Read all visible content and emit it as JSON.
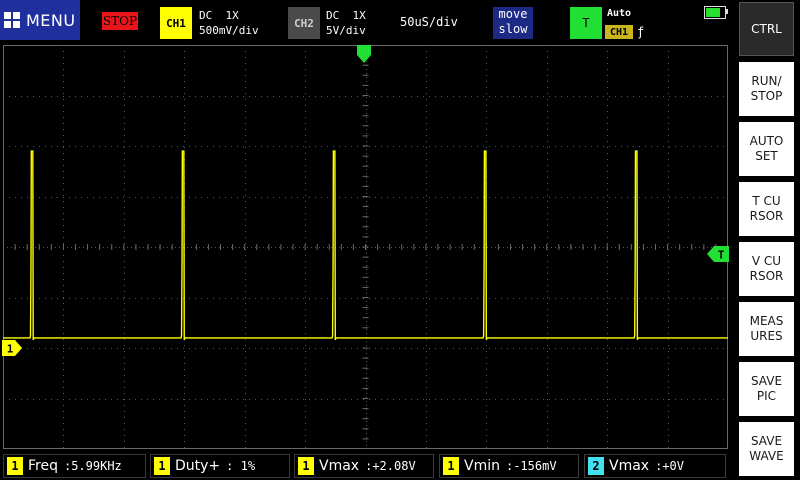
{
  "top_bar": {
    "menu_label": "MENU",
    "run_state": "STOP",
    "ch1": {
      "tag": "CH1",
      "coupling": "DC  1X",
      "scale": "500mV/div",
      "color": "#ffff00"
    },
    "ch2": {
      "tag": "CH2",
      "coupling": "DC  1X",
      "scale": "5V/div",
      "color": "#4a4a4a"
    },
    "timebase": "50uS/div",
    "move": {
      "line1": "move",
      "line2": "slow"
    },
    "trigger": {
      "tag": "T",
      "mode": "Auto",
      "source": "CH1",
      "edge": "ƒ",
      "color": "#22e033"
    },
    "battery_level": 0.8
  },
  "screen": {
    "grid": {
      "h_divisions": 12,
      "v_divisions": 8
    },
    "trigger_marker_label": "T",
    "ch1_marker_label": "1",
    "ch1_waveform": {
      "description_units": "divisions",
      "baseline_div": -1.8,
      "pulse_peak_div": 1.9,
      "pulse_count": 5
    }
  },
  "side_menu": [
    {
      "label": "CTRL",
      "active": true
    },
    {
      "label": "RUN/\nSTOP",
      "active": false
    },
    {
      "label": "AUTO\nSET",
      "active": false
    },
    {
      "label": "T CU\nRSOR",
      "active": false
    },
    {
      "label": "V CU\nRSOR",
      "active": false
    },
    {
      "label": "MEAS\nURES",
      "active": false
    },
    {
      "label": "SAVE\nPIC",
      "active": false
    },
    {
      "label": "SAVE\nWAVE",
      "active": false
    }
  ],
  "measurements": [
    {
      "ch": "1",
      "name": "Freq",
      "value": ":5.99KHz",
      "color": "yellow"
    },
    {
      "ch": "1",
      "name": "Duty+",
      "value": ": 1%",
      "color": "yellow"
    },
    {
      "ch": "1",
      "name": "Vmax",
      "value": ":+2.08V",
      "color": "yellow"
    },
    {
      "ch": "1",
      "name": "Vmin",
      "value": ":-156mV",
      "color": "yellow"
    },
    {
      "ch": "2",
      "name": "Vmax",
      "value": ":+0V",
      "color": "cyan"
    }
  ]
}
